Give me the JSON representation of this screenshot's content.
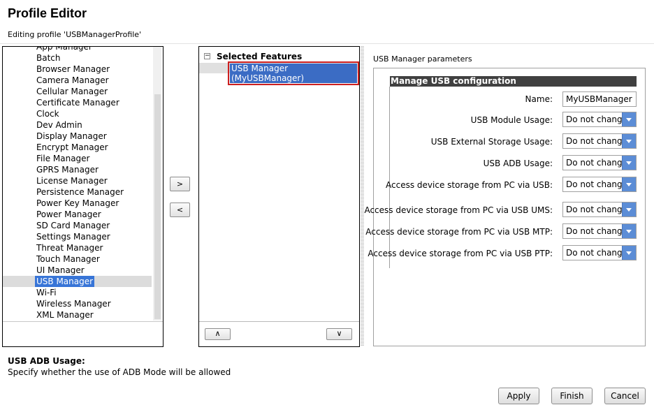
{
  "header": {
    "title": "Profile Editor",
    "subtitle": "Editing profile 'USBManagerProfile'"
  },
  "feature_list": {
    "items": [
      {
        "label": "App Manager",
        "selected": false
      },
      {
        "label": "Batch",
        "selected": false
      },
      {
        "label": "Browser Manager",
        "selected": false
      },
      {
        "label": "Camera Manager",
        "selected": false
      },
      {
        "label": "Cellular Manager",
        "selected": false
      },
      {
        "label": "Certificate Manager",
        "selected": false
      },
      {
        "label": "Clock",
        "selected": false
      },
      {
        "label": "Dev Admin",
        "selected": false
      },
      {
        "label": "Display Manager",
        "selected": false
      },
      {
        "label": "Encrypt Manager",
        "selected": false
      },
      {
        "label": "File Manager",
        "selected": false
      },
      {
        "label": "GPRS Manager",
        "selected": false
      },
      {
        "label": "License Manager",
        "selected": false
      },
      {
        "label": "Persistence Manager",
        "selected": false
      },
      {
        "label": "Power Key Manager",
        "selected": false
      },
      {
        "label": "Power Manager",
        "selected": false
      },
      {
        "label": "SD Card Manager",
        "selected": false
      },
      {
        "label": "Settings Manager",
        "selected": false
      },
      {
        "label": "Threat Manager",
        "selected": false
      },
      {
        "label": "Touch Manager",
        "selected": false
      },
      {
        "label": "UI Manager",
        "selected": false
      },
      {
        "label": "USB Manager",
        "selected": true
      },
      {
        "label": "Wi-Fi",
        "selected": false
      },
      {
        "label": "Wireless Manager",
        "selected": false
      },
      {
        "label": "XML Manager",
        "selected": false
      }
    ]
  },
  "transfer": {
    "add_label": ">",
    "remove_label": "<"
  },
  "selected_features": {
    "root_label": "Selected Features",
    "toggle": "−",
    "child_label": "USB Manager (MyUSBManager)",
    "move_up_label": "∧",
    "move_down_label": "∨"
  },
  "params": {
    "title": "USB Manager parameters",
    "group_title": "Manage USB configuration",
    "name_label": "Name:",
    "name_value": "MyUSBManager",
    "fields": [
      {
        "label": "USB Module Usage:",
        "value": "Do not change"
      },
      {
        "label": "USB External Storage Usage:",
        "value": "Do not change"
      },
      {
        "label": "USB ADB Usage:",
        "value": "Do not change"
      },
      {
        "label": "Access device storage from PC via USB:",
        "value": "Do not change"
      },
      {
        "label": "Access device storage from PC via USB UMS:",
        "value": "Do not change"
      },
      {
        "label": "Access device storage from PC via USB MTP:",
        "value": "Do not change"
      },
      {
        "label": "Access device storage from PC via USB PTP:",
        "value": "Do not change"
      }
    ]
  },
  "help": {
    "title": "USB ADB Usage:",
    "text": "Specify whether the use of ADB Mode will be allowed"
  },
  "footer": {
    "apply_label": "Apply",
    "finish_label": "Finish",
    "cancel_label": "Cancel"
  },
  "colors": {
    "selection": "#3875d7",
    "highlight_border": "#cc1f1f",
    "group_header": "#404040",
    "dropdown_button": "#5c8dd6"
  }
}
